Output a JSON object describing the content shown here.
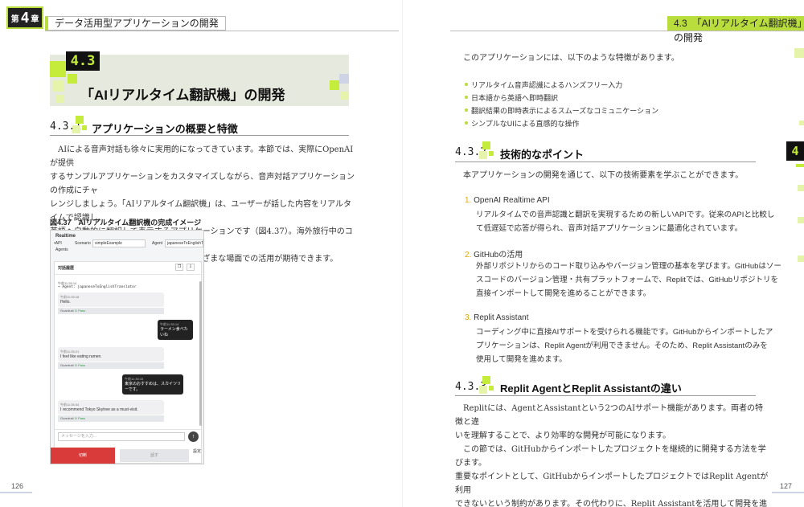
{
  "header": {
    "chapter_prefix": "第",
    "chapter_number": "4",
    "chapter_suffix": "章",
    "chapter_title": "データ活用型アプリケーションの開発",
    "section_tab": "4.3　「AIリアルタイム翻訳機」の開発",
    "side_tab": "4"
  },
  "left": {
    "section_number": "4.3",
    "section_title": "「AIリアルタイム翻訳機」の開発",
    "sub1_number": "4.3.1",
    "sub1_title": "アプリケーションの概要と特徴",
    "paragraph_lines": [
      "AIによる音声対話も徐々に実用的になってきています。本節では、実際にOpenAIが提供",
      "するサンプルアプリケーションをカスタマイズしながら、音声対話アプリケーションの作成にチャ",
      "レンジしましょう。「AIリアルタイム翻訳機」は、ユーザーが話した内容をリアルタイムで認識し、",
      "英語へ自動的に翻訳して表示するアプリケーションです（図4.37）。海外旅行中のコミュニケー",
      "ション支援や、語学学習の補助など、さまざまな場面での活用が期待できます。"
    ],
    "figure_caption": "図4.37　AIリアルタイム翻訳機の完成イメージ",
    "page_number": "126"
  },
  "app": {
    "header_title": "Realtime",
    "api_label": "•API",
    "agents_label": "Agents",
    "scenario_label": "Scenario",
    "scenario_value": "simpleExample",
    "agent_label": "Agent",
    "agent_value": "japaneseToEnglishT",
    "panel_title": "対話履歴",
    "log_time": "午前11:35:14",
    "log_agent": "→ Agent: japaneseToEnglishTranslator",
    "messages": [
      {
        "time": "午前11:35:18",
        "text": "Hello.",
        "guard": "Guardrail",
        "status": "Pass"
      },
      {
        "time": "午前11:35:14",
        "text": "ラーメン食べたいね"
      },
      {
        "time": "午前11:35:21",
        "text": "I feel like eating ramen.",
        "guard": "Guardrail",
        "status": "Pass"
      },
      {
        "time": "午前11:35:33",
        "text": "東京のおすすめは、スカイツリーです。"
      },
      {
        "time": "午前11:35:34",
        "text": "I recommend Tokyo Skytree as a must-visit.",
        "guard": "Guardrail",
        "status": "Pass"
      }
    ],
    "input_placeholder": "メッセージを入力...",
    "disconnect_label": "切断",
    "talk_label": "話す",
    "settings_label": "設定"
  },
  "right": {
    "intro": "このアプリケーションには、以下のような特徴があります。",
    "features": [
      "リアルタイム音声認識によるハンズフリー入力",
      "日本語から英語へ即時翻訳",
      "翻訳結果の即時表示によるスムーズなコミュニケーション",
      "シンプルなUIによる直感的な操作"
    ],
    "sub2_number": "4.3.2",
    "sub2_title": "技術的なポイント",
    "sub2_intro": "本アプリケーションの開発を通じて、以下の技術要素を学ぶことができます。",
    "points": [
      {
        "n": "1.",
        "title": "OpenAI Realtime API",
        "lines": [
          "リアルタイムでの音声認識と翻訳を実現するための新しいAPIです。従来のAPIと比較し",
          "て低遅延で応答が得られ、音声対話アプリケーションに最適化されています。"
        ]
      },
      {
        "n": "2.",
        "title": "GitHubの活用",
        "lines": [
          "外部リポジトリからのコード取り込みやバージョン管理の基本を学びます。GitHubはソー",
          "スコードのバージョン管理・共有プラットフォームで、Replitでは、GitHubリポジトリを",
          "直接インポートして開発を進めることができます。"
        ]
      },
      {
        "n": "3.",
        "title": "Replit Assistant",
        "lines": [
          "コーディング中に直接AIサポートを受けられる機能です。GitHubからインポートしたア",
          "プリケーションは、Replit Agentが利用できません。そのため、Replit Assistantのみを",
          "使用して開発を進めます。"
        ]
      }
    ],
    "sub3_number": "4.3.3",
    "sub3_title": "Replit AgentとReplit Assistantの違い",
    "sub3_lines": [
      "Replitには、AgentとAssistantという2つのAIサポート機能があります。両者の特徴と違",
      "いを理解することで、より効率的な開発が可能になります。",
      "この節では、GitHubからインポートしたプロジェクトを継続的に開発する方法を学びます。",
      "重要なポイントとして、GitHubからインポートしたプロジェクトではReplit Agentが利用",
      "できないという制約があります。その代わりに、Replit Assistantを活用して開発を進めてい"
    ],
    "page_number": "127"
  },
  "colors": {
    "accent": "#b9dd3c",
    "number": "#e0a800"
  }
}
